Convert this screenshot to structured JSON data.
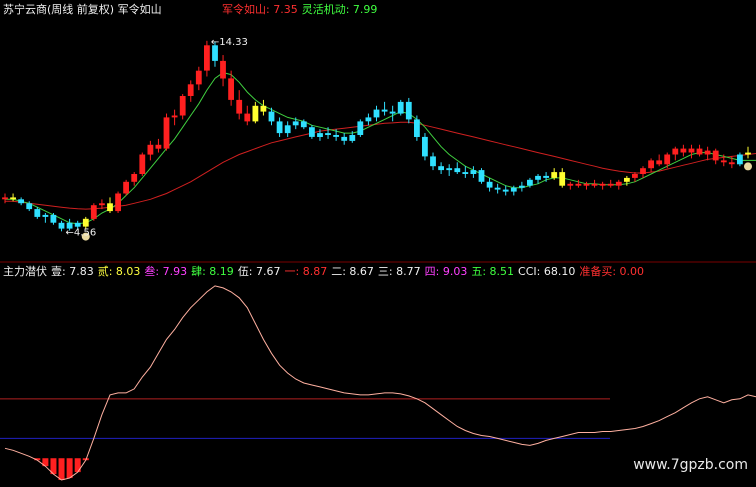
{
  "main_title": "苏宁云商(周线 前复权) 军令如山",
  "main_legend": [
    {
      "label": "军令如山:",
      "value": "7.35",
      "color": "#ff3030"
    },
    {
      "label": "灵活机动:",
      "value": "7.99",
      "color": "#40ff40"
    }
  ],
  "high_label": "14.33",
  "low_label": "4.56",
  "indicator_legend": [
    {
      "label": "主力潜伏",
      "value": "",
      "color": "#f0f0f0"
    },
    {
      "label": "壹:",
      "value": "7.83",
      "color": "#f0f0f0"
    },
    {
      "label": "贰:",
      "value": "8.03",
      "color": "#ffff40"
    },
    {
      "label": "叁:",
      "value": "7.93",
      "color": "#ff40ff"
    },
    {
      "label": "肆:",
      "value": "8.19",
      "color": "#40ff40"
    },
    {
      "label": "伍:",
      "value": "7.67",
      "color": "#f0f0f0"
    },
    {
      "label": "一:",
      "value": "8.87",
      "color": "#ff3030"
    },
    {
      "label": "二:",
      "value": "8.67",
      "color": "#f0f0f0"
    },
    {
      "label": "三:",
      "value": "8.77",
      "color": "#f0f0f0"
    },
    {
      "label": "四:",
      "value": "9.03",
      "color": "#ff40ff"
    },
    {
      "label": "五:",
      "value": "8.51",
      "color": "#40ff40"
    },
    {
      "label": "CCI:",
      "value": "68.10",
      "color": "#f0f0f0"
    },
    {
      "label": "准备买:",
      "value": "0.00",
      "color": "#ff3030"
    }
  ],
  "watermark": "www.7gpzb.com",
  "colors": {
    "up": "#ff2020",
    "down": "#30e0ff",
    "signal": "#ffff30",
    "ma_fast": "#40d040",
    "ma_slow": "#d02020",
    "cci": "#ffb0a0",
    "ref_high": "#b02020",
    "ref_low": "#2020c0"
  },
  "chart_data": {
    "type": "candlestick",
    "price_ylim": [
      3.5,
      15.5
    ],
    "candles": [
      [
        6.2,
        6.5,
        6.0,
        6.3,
        "u"
      ],
      [
        6.3,
        6.5,
        6.1,
        6.2,
        "s"
      ],
      [
        6.2,
        6.3,
        5.9,
        6.0,
        "d"
      ],
      [
        6.0,
        6.1,
        5.6,
        5.7,
        "d"
      ],
      [
        5.7,
        5.8,
        5.2,
        5.3,
        "d"
      ],
      [
        5.3,
        5.5,
        5.0,
        5.4,
        "d"
      ],
      [
        5.4,
        5.5,
        4.9,
        5.0,
        "d"
      ],
      [
        5.0,
        5.1,
        4.56,
        4.7,
        "d"
      ],
      [
        4.7,
        5.2,
        4.6,
        5.0,
        "d"
      ],
      [
        5.0,
        5.1,
        4.7,
        4.8,
        "d"
      ],
      [
        4.8,
        5.3,
        4.7,
        5.2,
        "s"
      ],
      [
        5.2,
        6.0,
        5.1,
        5.9,
        "u"
      ],
      [
        5.9,
        6.2,
        5.7,
        6.0,
        "u"
      ],
      [
        6.0,
        6.3,
        5.5,
        5.6,
        "s"
      ],
      [
        5.6,
        6.6,
        5.5,
        6.5,
        "u"
      ],
      [
        6.5,
        7.2,
        6.4,
        7.1,
        "u"
      ],
      [
        7.1,
        7.6,
        6.9,
        7.5,
        "u"
      ],
      [
        7.5,
        8.6,
        7.4,
        8.5,
        "u"
      ],
      [
        8.5,
        9.2,
        8.2,
        9.0,
        "u"
      ],
      [
        9.0,
        9.3,
        8.6,
        8.8,
        "u"
      ],
      [
        8.8,
        10.6,
        8.7,
        10.4,
        "u"
      ],
      [
        10.4,
        10.8,
        10.0,
        10.5,
        "u"
      ],
      [
        10.5,
        11.6,
        10.3,
        11.5,
        "u"
      ],
      [
        11.5,
        12.3,
        11.2,
        12.1,
        "u"
      ],
      [
        12.1,
        13.0,
        11.8,
        12.8,
        "u"
      ],
      [
        12.8,
        14.33,
        12.5,
        14.1,
        "u"
      ],
      [
        14.1,
        14.3,
        13.0,
        13.3,
        "d"
      ],
      [
        13.3,
        13.6,
        12.0,
        12.4,
        "u"
      ],
      [
        12.4,
        12.8,
        11.0,
        11.3,
        "u"
      ],
      [
        11.3,
        11.8,
        10.3,
        10.6,
        "u"
      ],
      [
        10.6,
        11.0,
        10.0,
        10.2,
        "u"
      ],
      [
        10.2,
        11.2,
        10.1,
        11.0,
        "s"
      ],
      [
        11.0,
        11.3,
        10.5,
        10.7,
        "s"
      ],
      [
        10.7,
        10.9,
        10.0,
        10.2,
        "d"
      ],
      [
        10.2,
        10.4,
        9.4,
        9.6,
        "d"
      ],
      [
        9.6,
        10.2,
        9.4,
        10.0,
        "d"
      ],
      [
        10.0,
        10.4,
        9.8,
        10.2,
        "d"
      ],
      [
        10.2,
        10.3,
        9.8,
        9.9,
        "d"
      ],
      [
        9.9,
        10.0,
        9.3,
        9.4,
        "d"
      ],
      [
        9.4,
        9.8,
        9.2,
        9.6,
        "d"
      ],
      [
        9.6,
        9.9,
        9.3,
        9.5,
        "d"
      ],
      [
        9.5,
        9.8,
        9.2,
        9.4,
        "d"
      ],
      [
        9.4,
        9.6,
        9.0,
        9.2,
        "d"
      ],
      [
        9.2,
        9.7,
        9.1,
        9.5,
        "d"
      ],
      [
        9.5,
        10.3,
        9.4,
        10.2,
        "d"
      ],
      [
        10.2,
        10.6,
        10.0,
        10.4,
        "d"
      ],
      [
        10.4,
        11.0,
        10.2,
        10.8,
        "d"
      ],
      [
        10.8,
        11.2,
        10.5,
        10.7,
        "d"
      ],
      [
        10.7,
        11.0,
        10.2,
        10.6,
        "d"
      ],
      [
        10.6,
        11.3,
        10.5,
        11.2,
        "d"
      ],
      [
        11.2,
        11.4,
        10.1,
        10.3,
        "d"
      ],
      [
        10.3,
        10.5,
        9.2,
        9.4,
        "d"
      ],
      [
        9.4,
        9.6,
        8.2,
        8.4,
        "d"
      ],
      [
        8.4,
        8.6,
        7.7,
        7.9,
        "d"
      ],
      [
        7.9,
        8.1,
        7.5,
        7.7,
        "d"
      ],
      [
        7.7,
        8.0,
        7.4,
        7.8,
        "d"
      ],
      [
        7.8,
        8.1,
        7.5,
        7.6,
        "d"
      ],
      [
        7.6,
        7.9,
        7.3,
        7.5,
        "d"
      ],
      [
        7.5,
        7.9,
        7.3,
        7.7,
        "d"
      ],
      [
        7.7,
        7.8,
        7.0,
        7.1,
        "d"
      ],
      [
        7.1,
        7.3,
        6.6,
        6.8,
        "d"
      ],
      [
        6.8,
        7.0,
        6.5,
        6.7,
        "d"
      ],
      [
        6.7,
        6.9,
        6.4,
        6.6,
        "d"
      ],
      [
        6.6,
        6.9,
        6.4,
        6.8,
        "d"
      ],
      [
        6.8,
        7.1,
        6.6,
        6.9,
        "d"
      ],
      [
        6.9,
        7.3,
        6.8,
        7.2,
        "d"
      ],
      [
        7.2,
        7.5,
        7.0,
        7.4,
        "d"
      ],
      [
        7.4,
        7.6,
        7.1,
        7.3,
        "d"
      ],
      [
        7.3,
        7.8,
        7.2,
        7.6,
        "s"
      ],
      [
        7.6,
        7.8,
        6.8,
        6.9,
        "s"
      ],
      [
        6.9,
        7.1,
        6.7,
        7.0,
        "u"
      ],
      [
        7.0,
        7.2,
        6.8,
        6.9,
        "u"
      ],
      [
        6.9,
        7.1,
        6.7,
        7.0,
        "u"
      ],
      [
        7.0,
        7.2,
        6.8,
        6.9,
        "u"
      ],
      [
        6.9,
        7.1,
        6.7,
        7.0,
        "u"
      ],
      [
        7.0,
        7.2,
        6.8,
        6.9,
        "u"
      ],
      [
        6.9,
        7.2,
        6.7,
        7.1,
        "u"
      ],
      [
        7.1,
        7.4,
        6.9,
        7.3,
        "s"
      ],
      [
        7.3,
        7.6,
        7.1,
        7.5,
        "u"
      ],
      [
        7.5,
        7.9,
        7.3,
        7.8,
        "u"
      ],
      [
        7.8,
        8.3,
        7.6,
        8.2,
        "u"
      ],
      [
        8.2,
        8.5,
        7.9,
        8.0,
        "u"
      ],
      [
        8.0,
        8.6,
        7.8,
        8.5,
        "u"
      ],
      [
        8.5,
        8.9,
        8.2,
        8.8,
        "u"
      ],
      [
        8.8,
        9.0,
        8.4,
        8.6,
        "u"
      ],
      [
        8.6,
        9.0,
        8.3,
        8.8,
        "u"
      ],
      [
        8.8,
        9.0,
        8.4,
        8.5,
        "u"
      ],
      [
        8.5,
        8.9,
        8.2,
        8.7,
        "u"
      ],
      [
        8.7,
        8.8,
        8.0,
        8.2,
        "u"
      ],
      [
        8.2,
        8.5,
        7.9,
        8.1,
        "u"
      ],
      [
        8.1,
        8.4,
        7.8,
        8.0,
        "u"
      ],
      [
        8.0,
        8.6,
        7.9,
        8.5,
        "d"
      ],
      [
        8.5,
        8.9,
        8.3,
        8.6,
        "s"
      ]
    ],
    "ma_fast": [
      6.2,
      6.2,
      6.1,
      6.0,
      5.8,
      5.6,
      5.4,
      5.2,
      5.0,
      4.95,
      5.0,
      5.2,
      5.5,
      5.7,
      6.0,
      6.4,
      6.8,
      7.3,
      7.8,
      8.3,
      8.8,
      9.3,
      9.9,
      10.5,
      11.1,
      11.8,
      12.4,
      12.7,
      12.6,
      12.2,
      11.7,
      11.3,
      11.0,
      10.8,
      10.6,
      10.4,
      10.3,
      10.2,
      10.0,
      9.9,
      9.8,
      9.7,
      9.6,
      9.6,
      9.7,
      9.9,
      10.1,
      10.3,
      10.5,
      10.7,
      10.6,
      10.3,
      9.9,
      9.4,
      8.9,
      8.5,
      8.2,
      7.9,
      7.7,
      7.5,
      7.3,
      7.1,
      6.9,
      6.8,
      6.8,
      6.9,
      7.0,
      7.2,
      7.3,
      7.3,
      7.2,
      7.1,
      7.0,
      7.0,
      6.95,
      6.95,
      6.95,
      7.0,
      7.1,
      7.3,
      7.5,
      7.7,
      7.9,
      8.1,
      8.3,
      8.5,
      8.6,
      8.6,
      8.5,
      8.4,
      8.3,
      8.2,
      8.2,
      8.2
    ],
    "ma_slow": [
      6.1,
      6.1,
      6.05,
      6.0,
      5.95,
      5.9,
      5.85,
      5.8,
      5.75,
      5.72,
      5.7,
      5.72,
      5.75,
      5.8,
      5.85,
      5.9,
      6.0,
      6.1,
      6.2,
      6.35,
      6.5,
      6.7,
      6.9,
      7.1,
      7.35,
      7.6,
      7.85,
      8.1,
      8.3,
      8.5,
      8.65,
      8.8,
      8.95,
      9.1,
      9.2,
      9.3,
      9.4,
      9.5,
      9.6,
      9.7,
      9.75,
      9.8,
      9.85,
      9.9,
      9.95,
      10.0,
      10.05,
      10.1,
      10.12,
      10.15,
      10.15,
      10.1,
      10.0,
      9.9,
      9.8,
      9.7,
      9.6,
      9.5,
      9.4,
      9.3,
      9.2,
      9.1,
      9.0,
      8.9,
      8.8,
      8.7,
      8.6,
      8.5,
      8.4,
      8.3,
      8.2,
      8.1,
      8.0,
      7.9,
      7.8,
      7.72,
      7.65,
      7.6,
      7.55,
      7.55,
      7.6,
      7.65,
      7.75,
      7.85,
      7.95,
      8.05,
      8.15,
      8.25,
      8.3,
      8.35,
      8.4,
      8.45,
      8.5,
      8.55
    ],
    "cci": [
      -150,
      -160,
      -175,
      -190,
      -210,
      -240,
      -280,
      -310,
      -300,
      -270,
      -210,
      -100,
      20,
      120,
      130,
      130,
      150,
      210,
      260,
      330,
      400,
      450,
      510,
      560,
      600,
      640,
      670,
      660,
      640,
      610,
      560,
      480,
      400,
      330,
      270,
      230,
      200,
      180,
      170,
      160,
      150,
      140,
      130,
      125,
      120,
      120,
      125,
      130,
      130,
      125,
      115,
      100,
      80,
      50,
      20,
      -10,
      -40,
      -60,
      -75,
      -85,
      -90,
      -100,
      -110,
      -120,
      -130,
      -135,
      -125,
      -110,
      -100,
      -90,
      -80,
      -70,
      -70,
      -70,
      -65,
      -65,
      -60,
      -55,
      -50,
      -40,
      -25,
      -10,
      10,
      30,
      55,
      80,
      100,
      110,
      95,
      80,
      95,
      100,
      120,
      110,
      100
    ],
    "cci_ylim": [
      -320,
      700
    ],
    "cci_refs": [
      100,
      -100
    ],
    "buy_markers": [
      10
    ],
    "sell_markers": [
      98
    ]
  }
}
